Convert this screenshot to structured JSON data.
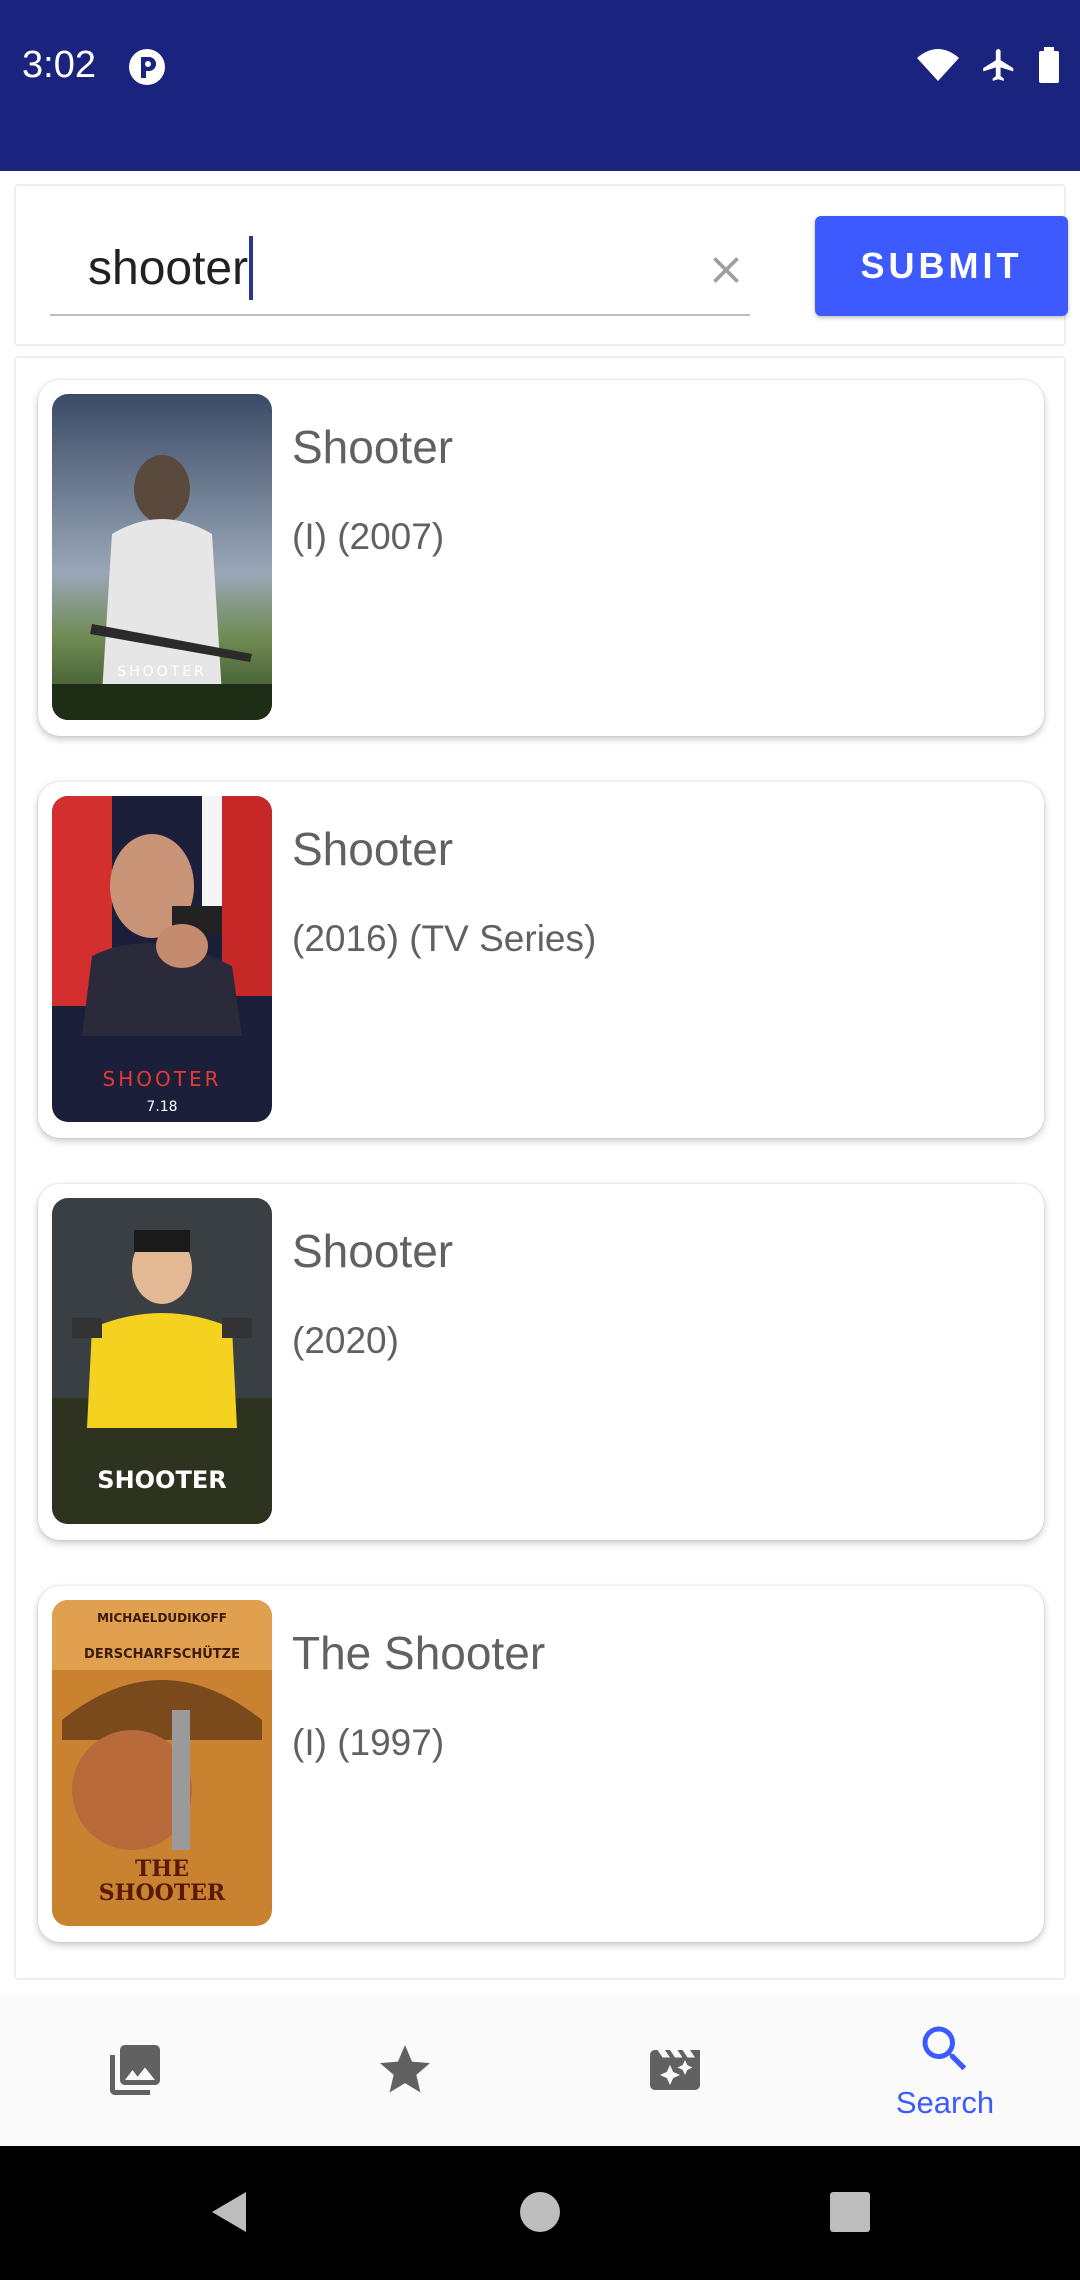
{
  "status_bar": {
    "time": "3:02",
    "background": "#1a237e"
  },
  "search": {
    "value": "shooter",
    "submit_label": "SUBMIT",
    "accent": "#3d5afe"
  },
  "results": [
    {
      "title": "Shooter",
      "subtitle": "(I) (2007)"
    },
    {
      "title": "Shooter",
      "subtitle": "(2016) (TV Series)"
    },
    {
      "title": "Shooter",
      "subtitle": "(2020)"
    },
    {
      "title": "The Shooter",
      "subtitle": "(I) (1997)"
    }
  ],
  "bottom_nav": {
    "items": [
      {
        "icon": "photo-library-icon",
        "label": ""
      },
      {
        "icon": "star-icon",
        "label": ""
      },
      {
        "icon": "movie-filter-icon",
        "label": ""
      },
      {
        "icon": "search-icon",
        "label": "Search",
        "active": true
      }
    ]
  }
}
